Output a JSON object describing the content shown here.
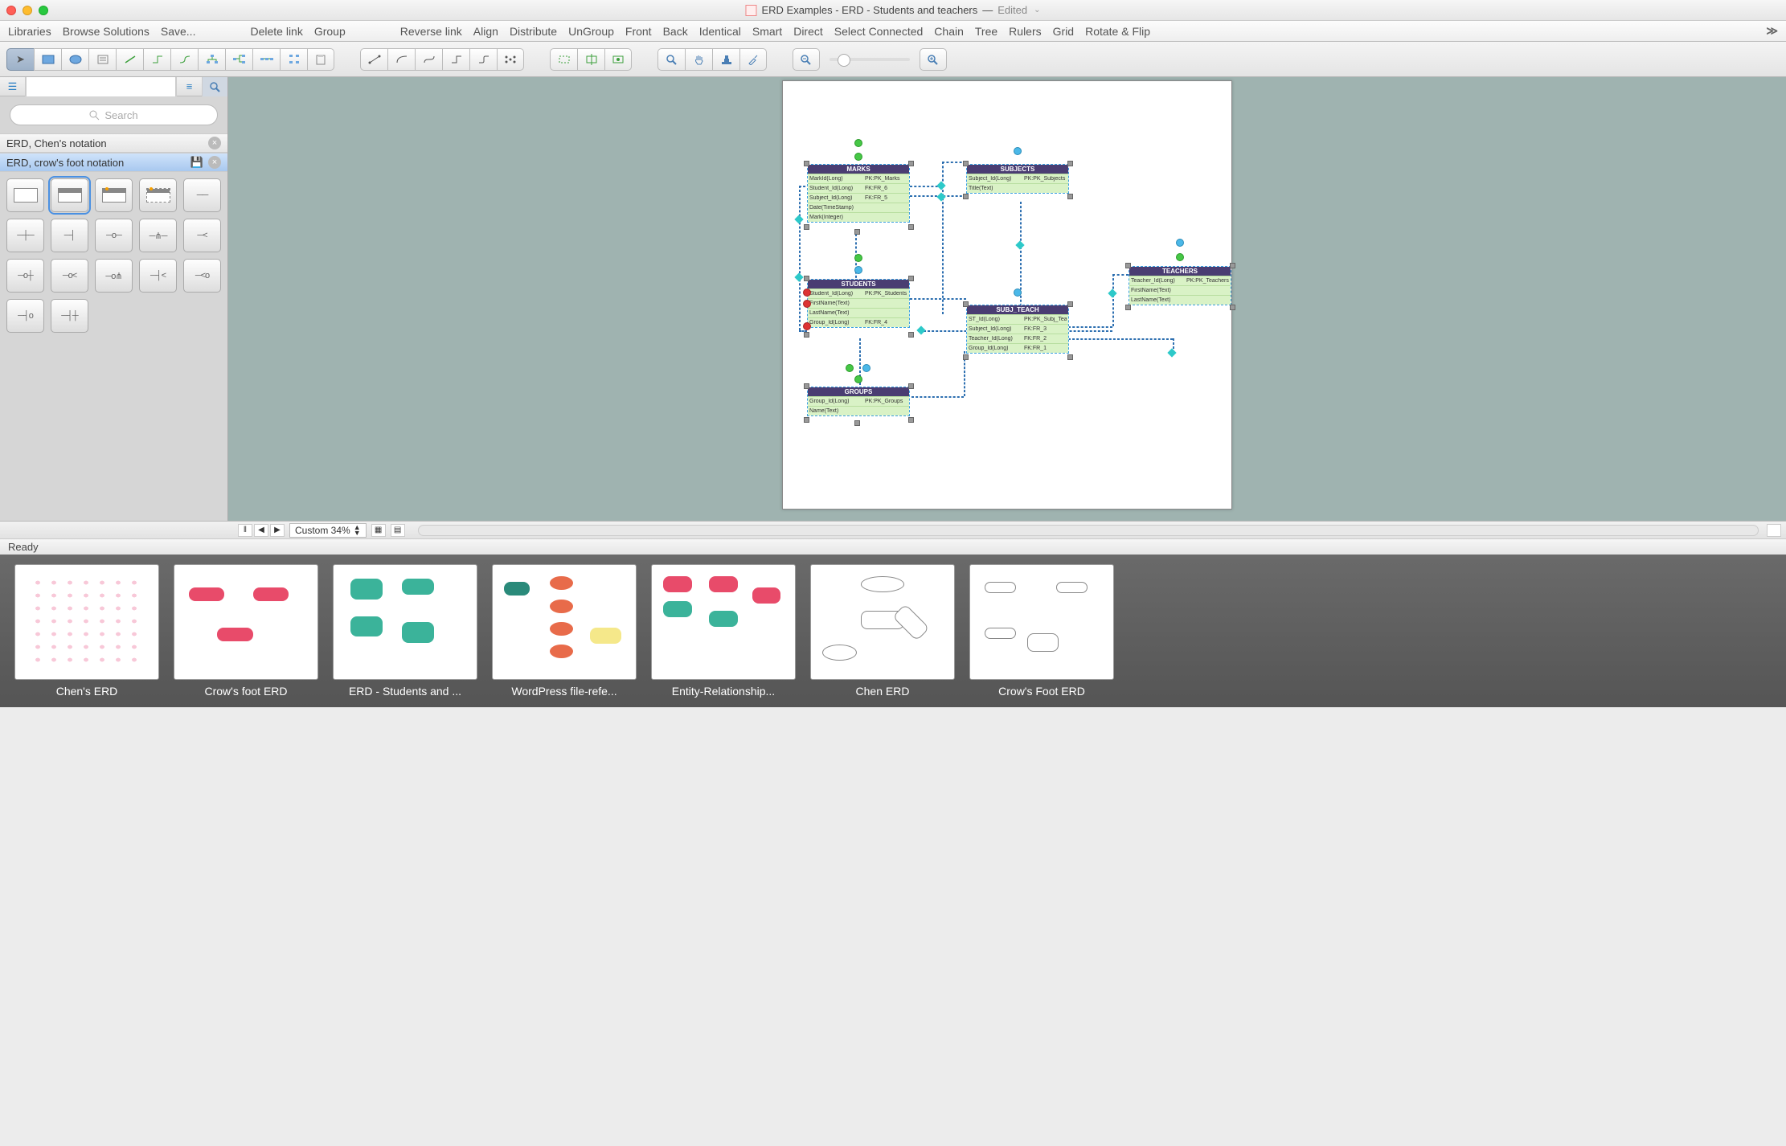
{
  "window": {
    "title_prefix": "ERD Examples - ERD - Students and teachers",
    "dash": "—",
    "edited": "Edited",
    "chev": "⌄"
  },
  "menu": [
    "Libraries",
    "Browse Solutions",
    "Save..."
  ],
  "menu2": [
    "Delete link",
    "Group"
  ],
  "menu3": [
    "Reverse link",
    "Align",
    "Distribute",
    "UnGroup",
    "Front",
    "Back",
    "Identical",
    "Smart",
    "Direct",
    "Select Connected",
    "Chain",
    "Tree",
    "Rulers",
    "Grid",
    "Rotate & Flip"
  ],
  "more": "≫",
  "search": {
    "placeholder": "Search"
  },
  "libs": {
    "chen": "ERD, Chen's notation",
    "crow": "ERD, crow's foot notation"
  },
  "zoom": {
    "label": "Custom 34%"
  },
  "status": "Ready",
  "entities": {
    "marks": {
      "title": "MARKS",
      "rows": [
        {
          "a": "MarkId(Long)",
          "b": "PK:PK_Marks"
        },
        {
          "a": "Student_Id(Long)",
          "b": "FK:FR_6"
        },
        {
          "a": "Subject_Id(Long)",
          "b": "FK:FR_5"
        },
        {
          "a": "Date(TimeStamp)",
          "b": ""
        },
        {
          "a": "Mark(Integer)",
          "b": ""
        }
      ]
    },
    "subjects": {
      "title": "SUBJECTS",
      "rows": [
        {
          "a": "Subject_Id(Long)",
          "b": "PK:PK_Subjects"
        },
        {
          "a": "Title(Text)",
          "b": ""
        }
      ]
    },
    "students": {
      "title": "STUDENTS",
      "rows": [
        {
          "a": "Student_Id(Long)",
          "b": "PK:PK_Students"
        },
        {
          "a": "FirstName(Text)",
          "b": ""
        },
        {
          "a": "LastName(Text)",
          "b": ""
        },
        {
          "a": "Group_Id(Long)",
          "b": "FK:FR_4"
        }
      ]
    },
    "teachers": {
      "title": "TEACHERS",
      "rows": [
        {
          "a": "Teacher_Id(Long)",
          "b": "PK:PK_Teachers"
        },
        {
          "a": "FirstName(Text)",
          "b": ""
        },
        {
          "a": "LastName(Text)",
          "b": ""
        }
      ]
    },
    "subjteach": {
      "title": "SUBJ_TEACH",
      "rows": [
        {
          "a": "ST_Id(Long)",
          "b": "PK:PK_Subj_Teach"
        },
        {
          "a": "Subject_Id(Long)",
          "b": "FK:FR_3"
        },
        {
          "a": "Teacher_Id(Long)",
          "b": "FK:FR_2"
        },
        {
          "a": "Group_Id(Long)",
          "b": "FK:FR_1"
        }
      ]
    },
    "groups": {
      "title": "GROUPS",
      "rows": [
        {
          "a": "Group_Id(Long)",
          "b": "PK:PK_Groups"
        },
        {
          "a": "Name(Text)",
          "b": ""
        }
      ]
    }
  },
  "thumbs": [
    "Chen's ERD",
    "Crow's foot ERD",
    "ERD - Students and ...",
    "WordPress file-refe...",
    "Entity-Relationship...",
    "Chen ERD",
    "Crow's Foot ERD"
  ],
  "rel_glyphs": [
    "──",
    "─┼─",
    "─┤",
    "─o─",
    "─⋔─",
    "─<",
    "─o┼",
    "─o<",
    "─o⋔",
    "─┤<",
    "─<o",
    "─┤o",
    "─┤┼"
  ]
}
